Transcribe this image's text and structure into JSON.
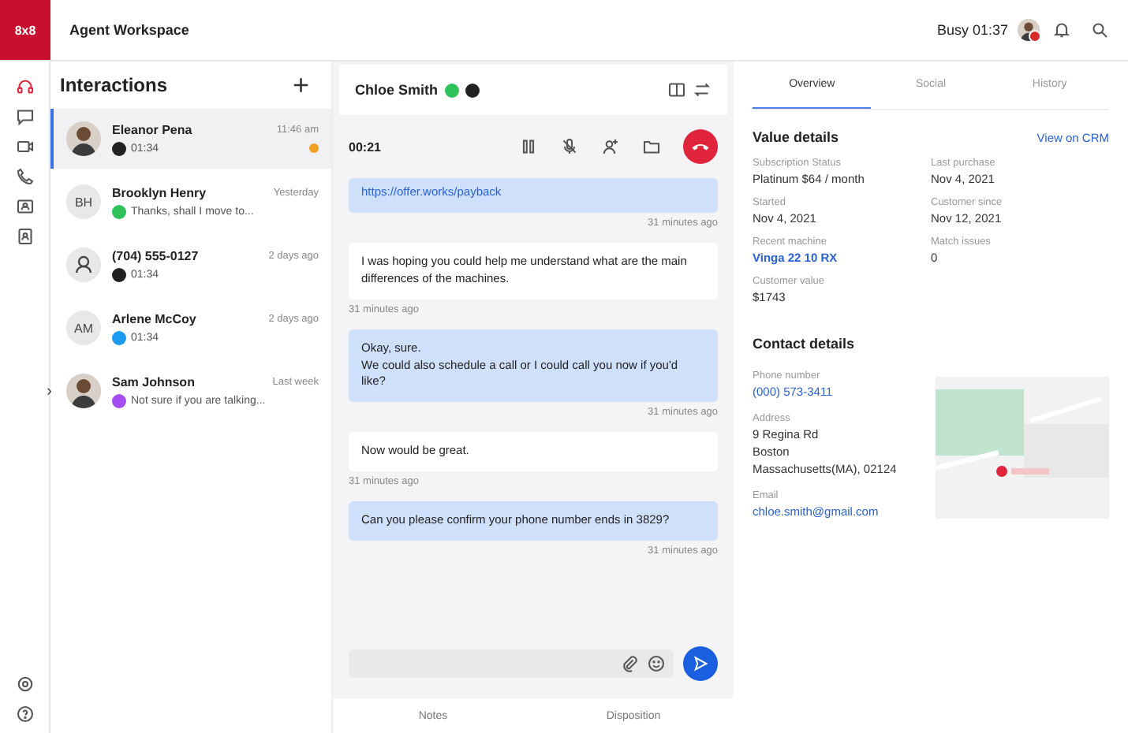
{
  "app": {
    "logo": "8x8",
    "title": "Agent Workspace",
    "status": "Busy 01:37"
  },
  "rail": {
    "items": [
      {
        "selected": true
      },
      {
        "selected": false
      },
      {
        "selected": false
      },
      {
        "selected": false
      },
      {
        "selected": false
      },
      {
        "selected": false
      }
    ],
    "expand": "›"
  },
  "interactions": {
    "title": "Interactions",
    "add": "+",
    "items": [
      {
        "name": "Eleanor Pena",
        "time": "11:46 am",
        "color": "#222222",
        "preview": "01:34",
        "selected": true,
        "unread": true
      },
      {
        "name": "Brooklyn Henry",
        "time": "Yesterday",
        "kind": "initials",
        "initials": "BH",
        "color": "#2fc25b",
        "preview": "Thanks, shall I move to...",
        "selected": false,
        "unread": false
      },
      {
        "name": "(704) 555-0127",
        "time": "2 days ago",
        "kind": "unknown",
        "color": "#222222",
        "preview": "01:34",
        "selected": false,
        "unread": false
      },
      {
        "name": "Arlene McCoy",
        "time": "2 days ago",
        "kind": "initials",
        "initials": "AM",
        "color": "#1d9bf0",
        "preview": "01:34",
        "selected": false,
        "unread": false
      },
      {
        "name": "Sam Johnson",
        "time": "Last week",
        "color": "#a44df0",
        "preview": "Not sure if you are talking...",
        "selected": false,
        "unread": false
      }
    ]
  },
  "chat": {
    "contact": "Chloe Smith",
    "call_timer": "00:21",
    "messages": [
      {
        "kind": "agent",
        "text": "https://offer.works/payback",
        "time": "31 minutes ago",
        "link": true
      },
      {
        "kind": "customer",
        "text": "I was hoping you could help me understand what are the main differences of the machines.",
        "time": "31 minutes ago",
        "link": false
      },
      {
        "kind": "agent",
        "text": "Okay, sure.\nWe could also schedule a call or I could call you now if you'd like?",
        "time": "31 minutes ago",
        "link": false
      },
      {
        "kind": "customer",
        "text": "Now would be great.",
        "time": "31 minutes ago",
        "link": false
      },
      {
        "kind": "agent",
        "text": "Can you please confirm your phone number ends in 3829?",
        "time": "31 minutes ago",
        "link": false
      }
    ],
    "tabs": [
      {
        "label": "Notes",
        "selected": false
      },
      {
        "label": "Disposition",
        "selected": false
      }
    ]
  },
  "details": {
    "tabs": [
      {
        "label": "Overview",
        "selected": true
      },
      {
        "label": "Social",
        "selected": false
      },
      {
        "label": "History",
        "selected": false
      }
    ],
    "value_title": "Value details",
    "crm_link": "View on CRM",
    "fields": [
      {
        "label": "Subscription Status",
        "value": "Platinum  $64 / month",
        "link": false
      },
      {
        "label": "Last purchase",
        "value": "Nov 4, 2021",
        "link": false
      },
      {
        "label": "Started",
        "value": "Nov 4, 2021",
        "link": false
      },
      {
        "label": "Customer since",
        "value": "Nov 12, 2021",
        "link": false
      },
      {
        "label": "Recent machine",
        "value": "Vinga 22 10 RX",
        "link": true
      },
      {
        "label": "Match issues",
        "value": "0",
        "link": false
      },
      {
        "label": "Customer value",
        "value": "$1743",
        "link": false
      }
    ],
    "contact_title": "Contact details",
    "contact": [
      {
        "label": "Phone number",
        "lines": [
          "(000) 573-3411"
        ],
        "link": true
      },
      {
        "label": "Address",
        "lines": [
          "9 Regina Rd",
          "Boston",
          "Massachusetts(MA), 02124"
        ],
        "link": false
      },
      {
        "label": "Email",
        "lines": [
          "chloe.smith@gmail.com"
        ],
        "link": true
      }
    ]
  }
}
